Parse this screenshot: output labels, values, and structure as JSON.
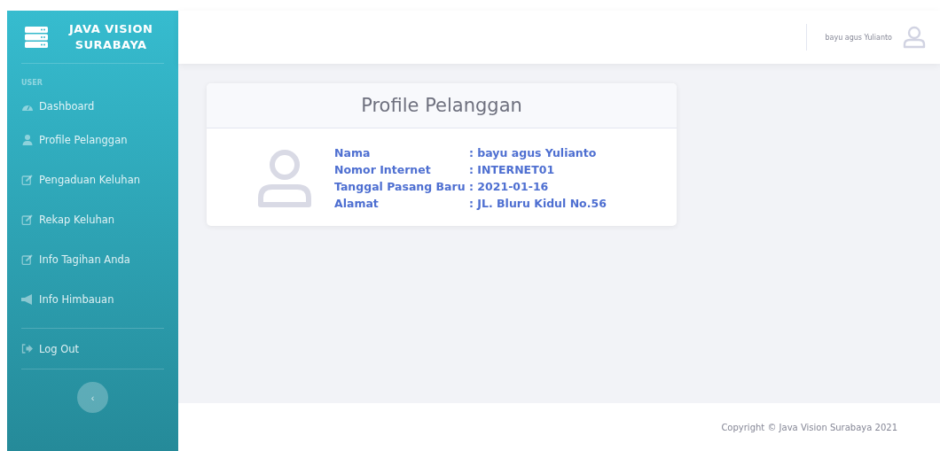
{
  "brand": {
    "line_1": "JAVA VISION",
    "line_2": "SURABAYA"
  },
  "sidebar": {
    "heading": "USER",
    "items": [
      {
        "label": "Dashboard",
        "kind": "dashboard"
      },
      {
        "label": "Profile Pelanggan",
        "kind": "user"
      },
      {
        "label": "Pengaduan Keluhan",
        "kind": "edit"
      },
      {
        "label": "Rekap Keluhan",
        "kind": "edit"
      },
      {
        "label": "Info Tagihan Anda",
        "kind": "edit"
      },
      {
        "label": "Info Himbauan",
        "kind": "megaphone"
      }
    ],
    "logout": "Log Out",
    "toggle": "‹"
  },
  "topbar": {
    "user_name": "bayu agus Yulianto"
  },
  "card": {
    "title": "Profile Pelanggan",
    "fields": [
      {
        "label": "Nama",
        "value": ": bayu agus Yulianto"
      },
      {
        "label": "Nomor Internet",
        "value": ": INTERNET01"
      },
      {
        "label": "Tanggal Pasang Baru",
        "value": ": 2021-01-16"
      },
      {
        "label": "Alamat",
        "value": ": JL. Bluru Kidul No.56"
      }
    ]
  },
  "footer": {
    "copyright": "Copyright © Java Vision Surabaya 2021"
  }
}
